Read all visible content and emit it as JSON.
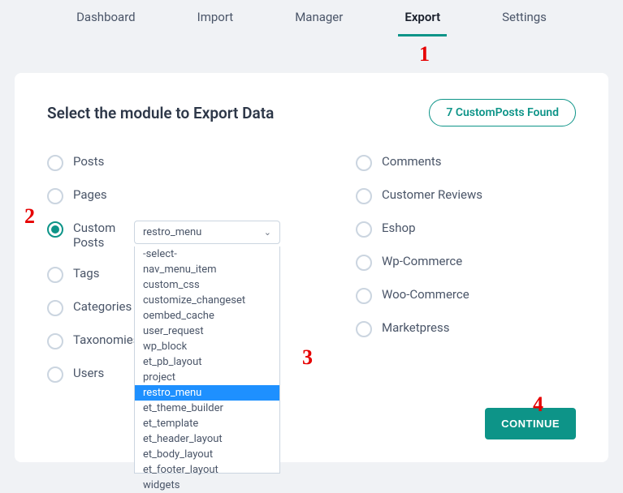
{
  "tabs": {
    "dashboard": "Dashboard",
    "import": "Import",
    "manager": "Manager",
    "export": "Export",
    "settings": "Settings"
  },
  "title": "Select the module to Export Data",
  "badge": "7 CustomPosts Found",
  "left": {
    "posts": "Posts",
    "pages": "Pages",
    "custom_posts_l1": "Custom",
    "custom_posts_l2": "Posts",
    "tags": "Tags",
    "categories": "Categories",
    "taxonomies": "Taxonomies",
    "users": "Users"
  },
  "right": {
    "comments": "Comments",
    "customer_reviews": "Customer Reviews",
    "eshop": "Eshop",
    "wp_commerce": "Wp-Commerce",
    "woo_commerce": "Woo-Commerce",
    "marketpress": "Marketpress"
  },
  "select": {
    "value": "restro_menu",
    "options": [
      "-select-",
      "nav_menu_item",
      "custom_css",
      "customize_changeset",
      "oembed_cache",
      "user_request",
      "wp_block",
      "et_pb_layout",
      "project",
      "restro_menu",
      "et_theme_builder",
      "et_template",
      "et_header_layout",
      "et_body_layout",
      "et_footer_layout",
      "widgets"
    ],
    "highlighted_index": 9
  },
  "continue": "CONTINUE",
  "annotations": {
    "a1": "1",
    "a2": "2",
    "a3": "3",
    "a4": "4"
  }
}
